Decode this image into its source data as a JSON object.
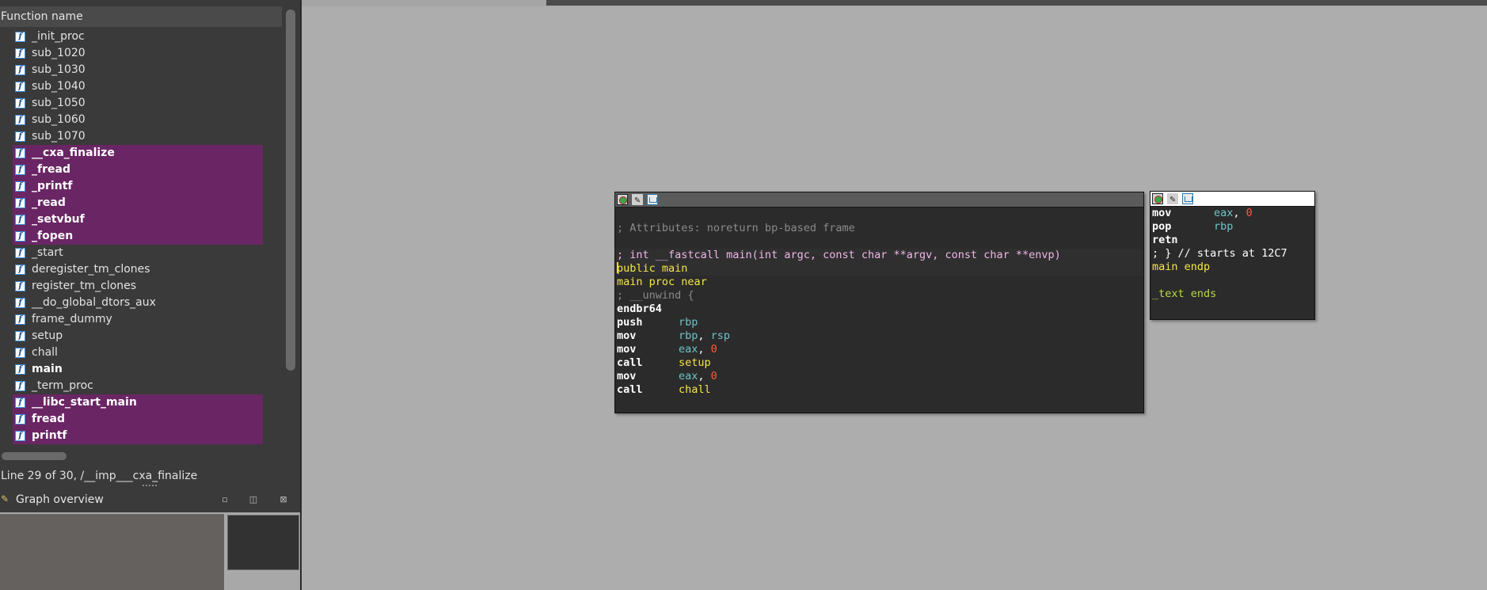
{
  "function_panel": {
    "header": "Function name",
    "functions": [
      {
        "name": "_init_proc",
        "style": "normal"
      },
      {
        "name": "sub_1020",
        "style": "normal"
      },
      {
        "name": "sub_1030",
        "style": "normal"
      },
      {
        "name": "sub_1040",
        "style": "normal"
      },
      {
        "name": "sub_1050",
        "style": "normal"
      },
      {
        "name": "sub_1060",
        "style": "normal"
      },
      {
        "name": "sub_1070",
        "style": "normal"
      },
      {
        "name": "__cxa_finalize",
        "style": "highlight"
      },
      {
        "name": "_fread",
        "style": "highlight"
      },
      {
        "name": "_printf",
        "style": "highlight"
      },
      {
        "name": "_read",
        "style": "highlight"
      },
      {
        "name": "_setvbuf",
        "style": "highlight"
      },
      {
        "name": "_fopen",
        "style": "highlight"
      },
      {
        "name": "_start",
        "style": "normal"
      },
      {
        "name": "deregister_tm_clones",
        "style": "normal"
      },
      {
        "name": "register_tm_clones",
        "style": "normal"
      },
      {
        "name": "__do_global_dtors_aux",
        "style": "normal"
      },
      {
        "name": "frame_dummy",
        "style": "normal"
      },
      {
        "name": "setup",
        "style": "normal"
      },
      {
        "name": "chall",
        "style": "normal"
      },
      {
        "name": "main",
        "style": "bold"
      },
      {
        "name": "_term_proc",
        "style": "normal"
      },
      {
        "name": "__libc_start_main",
        "style": "highlight"
      },
      {
        "name": "fread",
        "style": "highlight"
      },
      {
        "name": "printf",
        "style": "highlight"
      }
    ],
    "status_line": "Line 29 of 30, /__imp___cxa_finalize"
  },
  "graph_overview": {
    "title": "Graph overview",
    "icons": [
      "graph-overview-icon",
      "restore-icon",
      "float-icon",
      "close-icon"
    ]
  },
  "nodes": {
    "main_block": {
      "comment_attributes": "; Attributes: noreturn bp-based frame",
      "signature": "; int __fastcall main(int argc, const char **argv, const char **envp)",
      "public_decl": "public main",
      "proc_decl": "main proc near",
      "unwind": "; __unwind {",
      "instructions": [
        {
          "mnemonic": "endbr64",
          "operands": []
        },
        {
          "mnemonic": "push",
          "operands": [
            {
              "text": "rbp",
              "kind": "reg"
            }
          ]
        },
        {
          "mnemonic": "mov",
          "operands": [
            {
              "text": "rbp",
              "kind": "reg"
            },
            {
              "text": ", ",
              "kind": "plain"
            },
            {
              "text": "rsp",
              "kind": "reg"
            }
          ]
        },
        {
          "mnemonic": "mov",
          "operands": [
            {
              "text": "eax",
              "kind": "reg"
            },
            {
              "text": ", ",
              "kind": "plain"
            },
            {
              "text": "0",
              "kind": "num"
            }
          ]
        },
        {
          "mnemonic": "call",
          "operands": [
            {
              "text": "setup",
              "kind": "yel"
            }
          ]
        },
        {
          "mnemonic": "mov",
          "operands": [
            {
              "text": "eax",
              "kind": "reg"
            },
            {
              "text": ", ",
              "kind": "plain"
            },
            {
              "text": "0",
              "kind": "num"
            }
          ]
        },
        {
          "mnemonic": "call",
          "operands": [
            {
              "text": "chall",
              "kind": "yel"
            }
          ]
        }
      ]
    },
    "end_block": {
      "instructions": [
        {
          "mnemonic": "mov",
          "operands": [
            {
              "text": "eax",
              "kind": "reg"
            },
            {
              "text": ", ",
              "kind": "plain"
            },
            {
              "text": "0",
              "kind": "num"
            }
          ]
        },
        {
          "mnemonic": "pop",
          "operands": [
            {
              "text": "rbp",
              "kind": "reg"
            }
          ]
        },
        {
          "mnemonic": "retn",
          "operands": []
        }
      ],
      "end_comment": "; } // starts at 12C7",
      "endp": "main endp",
      "text_ends": "_text ends"
    }
  },
  "colors": {
    "highlight_row": "#6a2664",
    "register": "#6fc3c7",
    "number": "#ff5a3c",
    "name": "#f5e64a",
    "comment": "#8a8a8a",
    "signature": "#f0b8e8",
    "directive": "#b8d94a"
  }
}
